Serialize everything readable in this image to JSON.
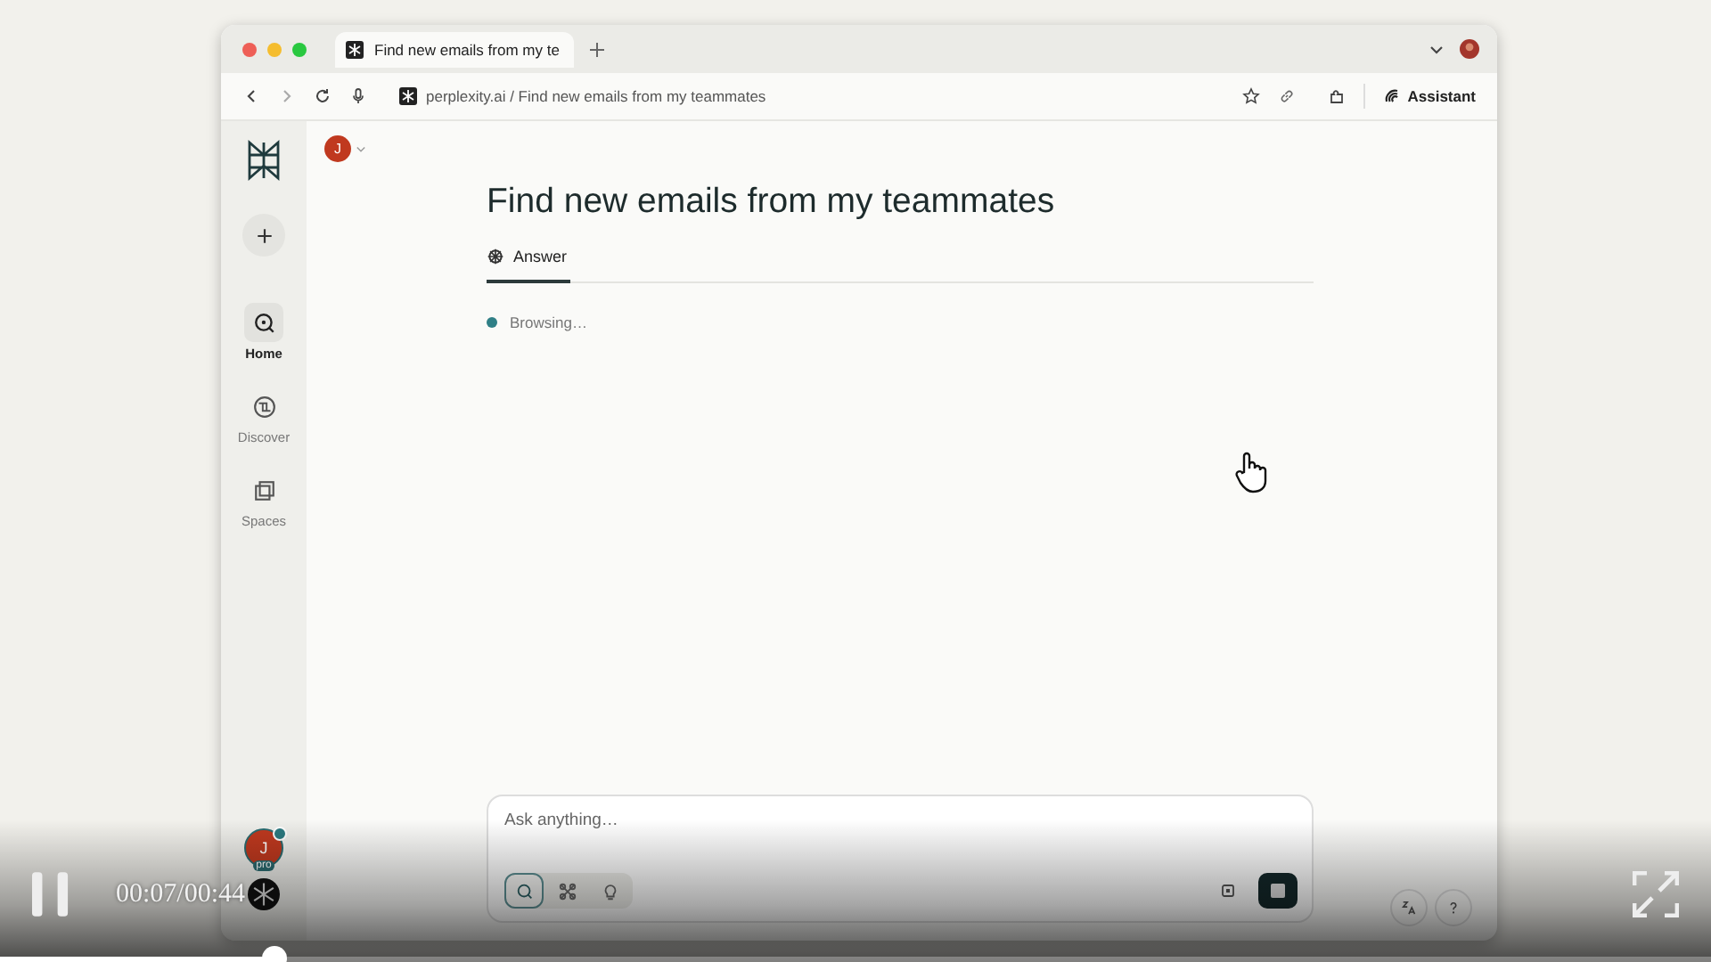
{
  "browser": {
    "tabs": [
      {
        "title": "Find new emails from my te",
        "selected": true
      }
    ],
    "address": "perplexity.ai / Find new emails from my teammates",
    "assistant_button": "Assistant"
  },
  "sidebar": {
    "items": [
      {
        "kind": "home",
        "label": "Home",
        "selected": true
      },
      {
        "kind": "discover",
        "label": "Discover",
        "selected": false
      },
      {
        "kind": "spaces",
        "label": "Spaces",
        "selected": false
      }
    ],
    "avatar_initial": "J",
    "badge": "pro"
  },
  "page": {
    "avatar_initial": "J",
    "title": "Find new emails from my teammates",
    "tabs": [
      {
        "label": "Answer",
        "selected": true
      }
    ],
    "status": "Browsing…",
    "input": {
      "placeholder": "Ask anything…"
    },
    "modes": [
      {
        "kind": "search",
        "selected": true
      },
      {
        "kind": "research",
        "selected": false
      },
      {
        "kind": "idea",
        "selected": false
      }
    ]
  },
  "video": {
    "playing": true,
    "time": "00:07/00:44",
    "level": 0.16
  }
}
